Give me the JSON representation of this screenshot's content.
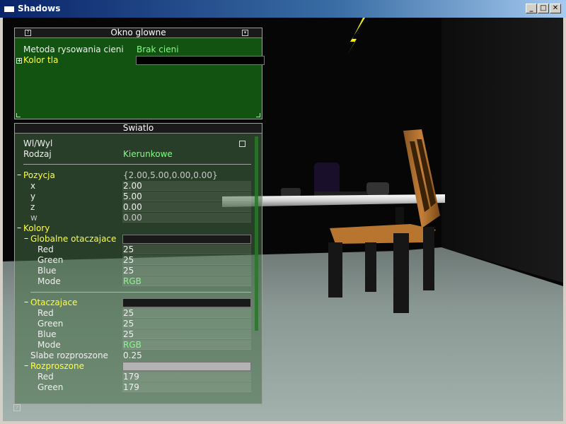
{
  "window": {
    "title": "Shadows",
    "buttons": {
      "minimize": "_",
      "maximize": "□",
      "close": "✕"
    }
  },
  "main_panel": {
    "title": "Okno glowne",
    "rows": {
      "shadow_method_label": "Metoda rysowania cieni",
      "shadow_method_value": "Brak cieni",
      "bg_color_label": "Kolor tla",
      "bg_color": "#000000"
    }
  },
  "light_panel": {
    "title": "Swiatlo",
    "onoff_label": "Wl/Wyl",
    "type_label": "Rodzaj",
    "type_value": "Kierunkowe",
    "position": {
      "label": "Pozycja",
      "summary": "{2.00,5.00,0.00,0.00}",
      "x_label": "x",
      "x_value": "2.00",
      "y_label": "y",
      "y_value": "5.00",
      "z_label": "z",
      "z_value": "0.00",
      "w_label": "w",
      "w_value": "0.00"
    },
    "colors": {
      "label": "Kolory",
      "global_ambient": {
        "label": "Globalne otaczajace",
        "swatch": "#191919",
        "red_label": "Red",
        "red": "25",
        "green_label": "Green",
        "green": "25",
        "blue_label": "Blue",
        "blue": "25",
        "mode_label": "Mode",
        "mode": "RGB"
      },
      "ambient": {
        "label": "Otaczajace",
        "swatch": "#191919",
        "red_label": "Red",
        "red": "25",
        "green_label": "Green",
        "green": "25",
        "blue_label": "Blue",
        "blue": "25",
        "mode_label": "Mode",
        "mode": "RGB"
      },
      "weak_diffuse_label": "Slabe rozproszone",
      "weak_diffuse_value": "0.25",
      "diffuse": {
        "label": "Rozproszone",
        "swatch": "#b3b3b3",
        "red_label": "Red",
        "red": "179",
        "green_label": "Green",
        "green": "179"
      }
    }
  },
  "colors": {
    "label_yellow": "#ffff40",
    "value_green": "#80ff80",
    "main_panel_bg": "#1a5a1a",
    "titlebar": "#0a246a"
  }
}
